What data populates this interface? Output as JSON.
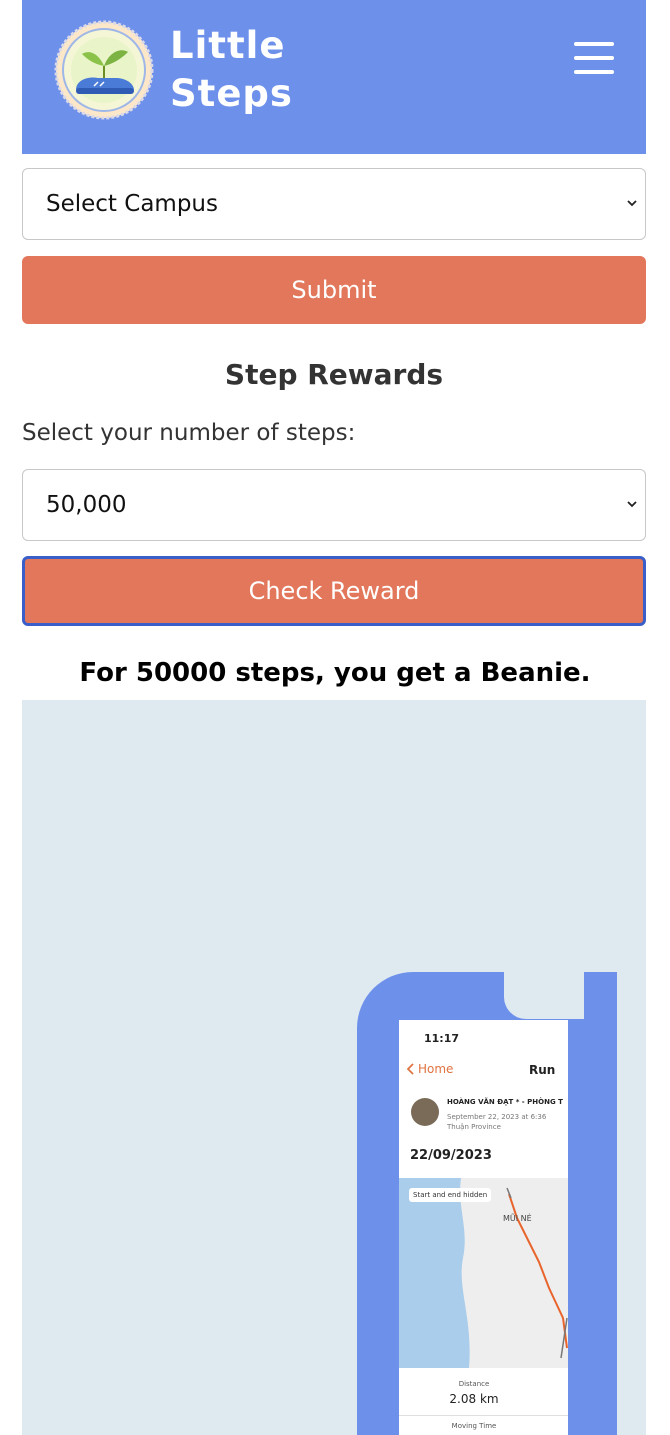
{
  "header": {
    "logo_line1": "Little",
    "logo_line2": "Steps",
    "menu_icon": "hamburger-menu-icon",
    "background_color": "#6d90eb"
  },
  "campus_form": {
    "select_value": "Select Campus",
    "submit_label": "Submit"
  },
  "rewards": {
    "title": "Step Rewards",
    "steps_label": "Select your number of steps:",
    "steps_value": "50,000",
    "check_label": "Check Reward",
    "result_text": "For 50000 steps, you get a Beanie."
  },
  "hero_phone": {
    "time": "11:17",
    "back_label": "Home",
    "activity_title": "Run",
    "athlete_name": "HOÀNG VĂN ĐẠT * - PHÒNG T",
    "activity_date_line": "September 22, 2023 at 6:36",
    "activity_location": "Thuận Province",
    "date": "22/09/2023",
    "map_tag": "Start and end hidden",
    "map_place": "MŨI NÉ",
    "distance_label": "Distance",
    "distance_value": "2.08 km",
    "moving_time_label": "Moving Time"
  },
  "colors": {
    "accent_button": "#e2775b",
    "focus_border": "#3a5fc8",
    "hero_background": "#dfe9f0",
    "route_color": "#e8642c"
  }
}
